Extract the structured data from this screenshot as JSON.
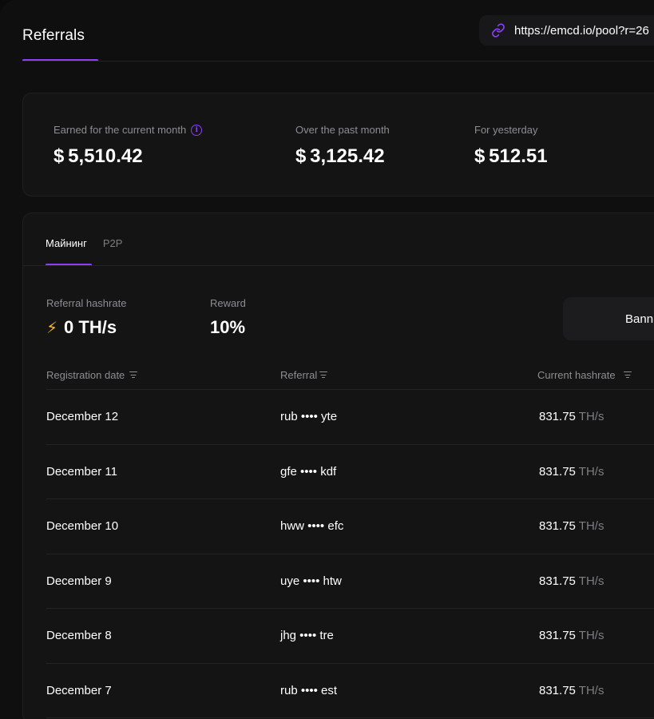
{
  "header": {
    "title": "Referrals",
    "referral_link": "https://emcd.io/pool?r=26"
  },
  "stats": [
    {
      "label": "Earned for the current month",
      "value": "$ 5,510.42",
      "has_info": true
    },
    {
      "label": "Over the past month",
      "value": "$ 3,125.42"
    },
    {
      "label": "For yesterday",
      "value": "$ 512.51"
    }
  ],
  "tabs": [
    {
      "label": "Майнинг",
      "active": true
    },
    {
      "label": "P2P",
      "active": false
    }
  ],
  "metrics": {
    "hashrate_label": "Referral hashrate",
    "hashrate_value": "0 TH/s",
    "reward_label": "Reward",
    "reward_value": "10%"
  },
  "banner_button": "Bann",
  "table": {
    "columns": [
      "Registration date",
      "Referral",
      "Current hashrate"
    ],
    "rows": [
      {
        "date": "December 12",
        "referral": "rub •••• yte",
        "hashrate": "831.75",
        "unit": "TH/s"
      },
      {
        "date": "December 11",
        "referral": "gfe •••• kdf",
        "hashrate": "831.75",
        "unit": "TH/s"
      },
      {
        "date": "December 10",
        "referral": "hww •••• efc",
        "hashrate": "831.75",
        "unit": "TH/s"
      },
      {
        "date": "December 9",
        "referral": "uye •••• htw",
        "hashrate": "831.75",
        "unit": "TH/s"
      },
      {
        "date": "December 8",
        "referral": "jhg •••• tre",
        "hashrate": "831.75",
        "unit": "TH/s"
      },
      {
        "date": "December 7",
        "referral": "rub •••• est",
        "hashrate": "831.75",
        "unit": "TH/s"
      }
    ]
  },
  "icons": {
    "link": "link-icon",
    "info": "info-icon",
    "bolt": "lightning-bolt-icon",
    "filter": "filter-icon"
  },
  "colors": {
    "accent": "#8a3ff2",
    "bolt": "#f5b921",
    "background": "#0f0f10",
    "card": "#141415"
  }
}
